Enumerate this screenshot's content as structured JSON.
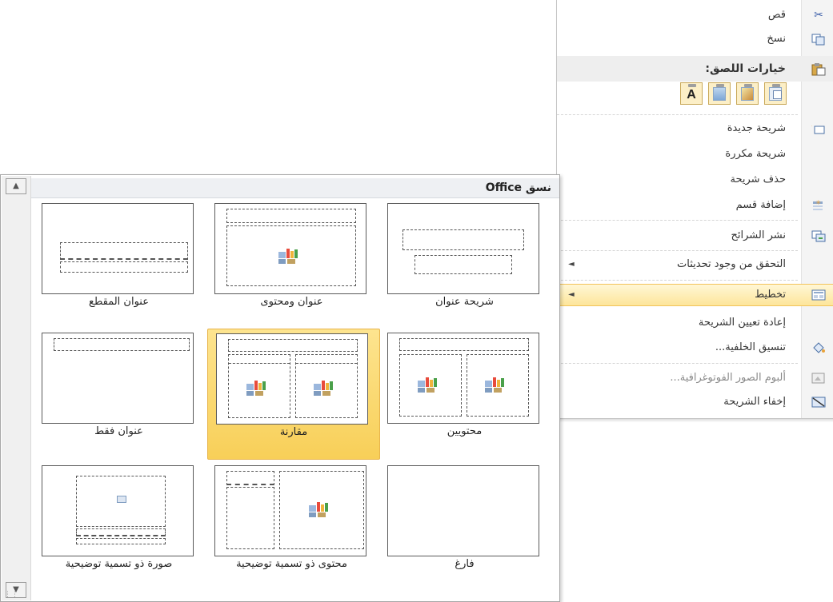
{
  "context_menu": {
    "cut": "قص",
    "copy": "نسخ",
    "paste_options_label": "خيارات اللصق:",
    "paste_keep_text_glyph": "A",
    "new_slide": "شريحة جديدة",
    "duplicate_slide": "شريحة مكررة",
    "delete_slide": "حذف شريحة",
    "add_section": "إضافة قسم",
    "publish_slides": "نشر الشرائح",
    "check_for_updates": "التحقق من وجود تحديثات",
    "layout": "تخطيط",
    "reset_slide": "إعادة تعيين الشريحة",
    "format_background": "تنسيق الخلفية...",
    "photo_album": "ألبوم الصور الفوتوغرافية...",
    "hide_slide": "إخفاء الشريحة"
  },
  "gallery": {
    "header": "نسق Office",
    "tiles": [
      {
        "label": "شريحة عنوان"
      },
      {
        "label": "عنوان ومحتوى"
      },
      {
        "label": "عنوان المقطع"
      },
      {
        "label": "محتويين"
      },
      {
        "label": "مقارنة"
      },
      {
        "label": "عنوان فقط"
      },
      {
        "label": "فارغ"
      },
      {
        "label": "محتوى ذو تسمية توضيحية"
      },
      {
        "label": "صورة ذو تسمية توضيحية"
      }
    ]
  },
  "icons": [
    "scissors-icon",
    "copy-icon",
    "paste-icon",
    "new-slide-icon",
    "add-section-icon",
    "publish-slides-icon",
    "layout-icon",
    "format-background-icon",
    "photo-album-icon",
    "hide-slide-icon",
    "content-placeholder-icon",
    "picture-placeholder-icon"
  ],
  "colors": {
    "highlight_top": "#fff7d6",
    "highlight_bottom": "#fde59a",
    "selected_tile": "#f8cf58",
    "header_bg": "#eef0f3"
  }
}
